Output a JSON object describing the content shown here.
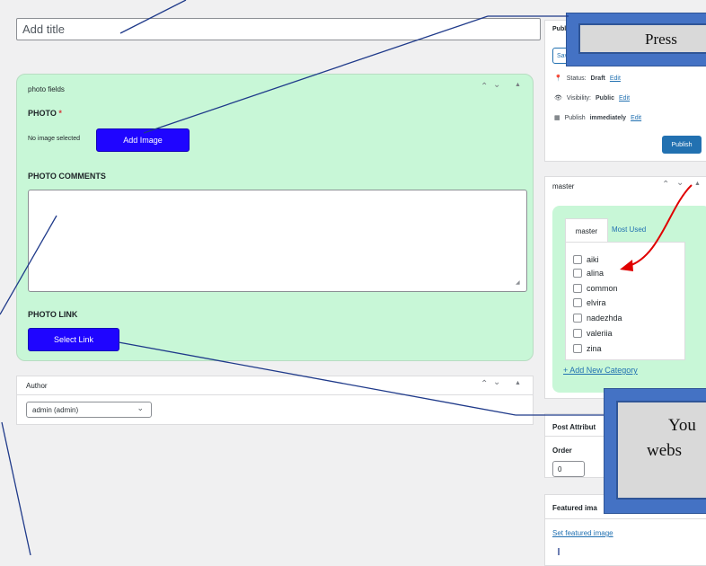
{
  "editor": {
    "title_placeholder": "Add title"
  },
  "photo_fields": {
    "header": "photo fields",
    "photo_label": "PHOTO",
    "required_mark": "*",
    "no_image_text": "No image selected",
    "add_image_button": "Add Image",
    "comments_label": "PHOTO COMMENTS",
    "link_label": "PHOTO LINK",
    "select_link_button": "Select Link"
  },
  "author": {
    "header": "Author",
    "selected": "admin (admin)"
  },
  "publish": {
    "header": "Publis",
    "save_button": "Save",
    "status_label": "Status:",
    "status_value": "Draft",
    "status_edit": "Edit",
    "visibility_label": "Visibility:",
    "visibility_value": "Public",
    "visibility_edit": "Edit",
    "publish_label": "Publish",
    "publish_value": "immediately",
    "publish_edit": "Edit",
    "publish_button": "Publish"
  },
  "master": {
    "header": "master",
    "tab_all": "master",
    "tab_most_used": "Most Used",
    "categories": [
      "aiki",
      "alina",
      "common",
      "elvira",
      "nadezhda",
      "valeriia",
      "zina"
    ],
    "add_new": "+ Add New Category"
  },
  "post_attributes": {
    "header": "Post Attribut",
    "order_label": "Order",
    "order_value": "0"
  },
  "featured": {
    "header": "Featured ima",
    "set_link": "Set featured image"
  },
  "callouts": {
    "press_text": "Press",
    "you_line1": "You",
    "you_line2": "webs"
  },
  "colors": {
    "accent_blue": "#1f05ff",
    "green_panel": "#c8f7d7",
    "link_blue": "#2271b1",
    "annotation_blue": "#4472c4",
    "annotation_red": "#e00000"
  }
}
